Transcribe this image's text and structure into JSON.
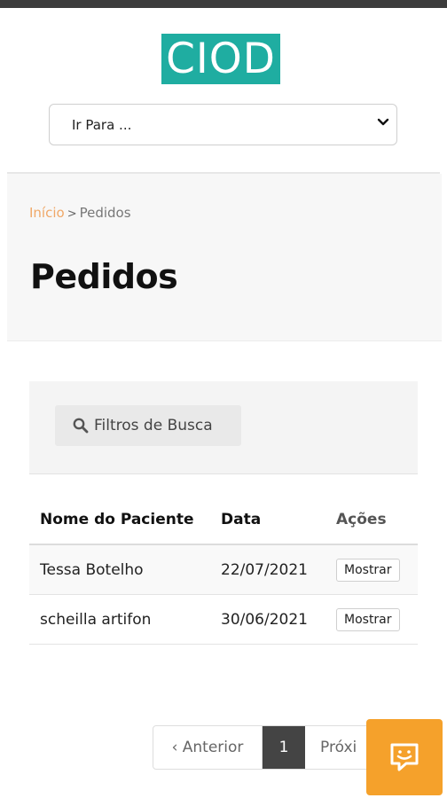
{
  "header": {
    "logo_text": "CIOD",
    "goto_select": {
      "selected": "Ir Para ..."
    }
  },
  "breadcrumb": {
    "home": "Início",
    "separator": ">",
    "current": "Pedidos"
  },
  "page": {
    "title": "Pedidos"
  },
  "filters": {
    "button_label": "Filtros de Busca",
    "icon": "search-icon"
  },
  "table": {
    "headers": {
      "patient": "Nome do Paciente",
      "date": "Data",
      "actions": "Ações"
    },
    "rows": [
      {
        "patient": "Tessa Botelho",
        "date": "22/07/2021",
        "action": "Mostrar"
      },
      {
        "patient": "scheilla artifon",
        "date": "30/06/2021",
        "action": "Mostrar"
      }
    ]
  },
  "pagination": {
    "previous": "‹ Anterior",
    "current": "1",
    "next": "Próxi"
  },
  "chat": {
    "icon": "chat-icon"
  },
  "colors": {
    "logo": "#1fada1",
    "chat": "#f5a12b",
    "breadcrumb_link": "#f0a868",
    "pager_active": "#444444"
  }
}
